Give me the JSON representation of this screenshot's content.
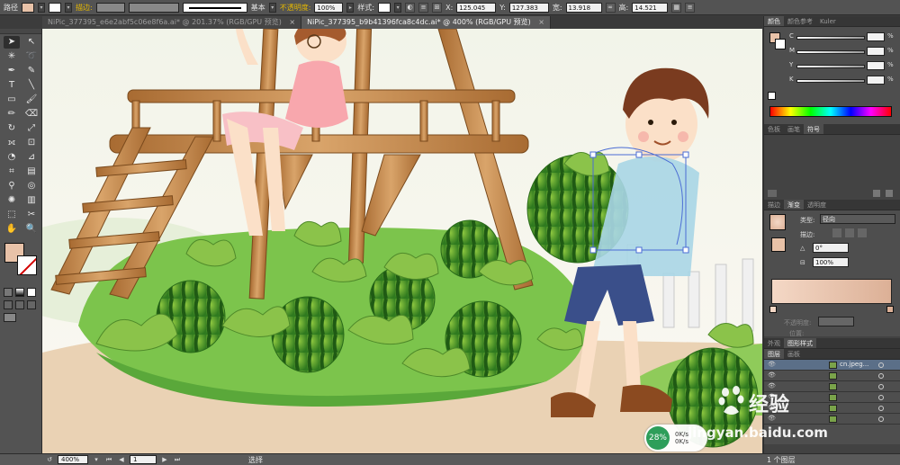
{
  "control_bar": {
    "path_label": "路径",
    "stroke_label": "描边:",
    "stroke_profile": "基本",
    "opacity_label": "不透明度:",
    "opacity_value": "100%",
    "style_label": "样式:",
    "x_label": "X:",
    "x_value": "125.045",
    "y_label": "Y:",
    "y_value": "127.383",
    "w_label": "宽:",
    "w_value": "13.918",
    "h_label": "高:",
    "h_value": "14.521",
    "fill_color": "#e8c2a8"
  },
  "tabs": [
    {
      "label": "NiPic_377395_e6e2abf5c06e8f6a.ai* @ 201.37% (RGB/GPU 预览)",
      "active": false
    },
    {
      "label": "NiPic_377395_b9b41396fca8c4dc.ai* @ 400% (RGB/GPU 预览)",
      "active": true
    }
  ],
  "toolbar": {
    "fill_color": "#e8c2a8",
    "stroke_color": "#ffffff"
  },
  "panels": {
    "color": {
      "tabs": [
        "颜色",
        "颜色参考",
        "Kuler"
      ],
      "channels": [
        "C",
        "M",
        "Y",
        "K"
      ],
      "percent": "%"
    },
    "swatches": {
      "tabs": [
        "色板",
        "画笔",
        "符号"
      ]
    },
    "gradient": {
      "tabs": [
        "描边",
        "渐变",
        "透明度"
      ],
      "type_label": "类型:",
      "type_value": "径向",
      "stroke_label": "描边:",
      "angle_value": "0°",
      "aspect_value": "100%",
      "opacity_label": "不透明度:",
      "location_label": "位置:",
      "start_color": "#f4d8c6",
      "end_color": "#dcb096"
    },
    "appearance": {
      "tabs": [
        "外观",
        "图形样式"
      ]
    },
    "layers": {
      "tabs": [
        "图层",
        "画板"
      ],
      "layer_name": "cn.jpeg...",
      "rows": 6
    }
  },
  "status_bar": {
    "zoom": "400%",
    "page": "1",
    "tool_status": "选择",
    "layers_count": "1 个图层"
  },
  "overlay": {
    "perf_percent": "28%",
    "speed_up": "0K/s",
    "speed_down": "0K/s"
  },
  "watermark": {
    "main": "经验",
    "sub": "jingyan.baidu.com"
  }
}
